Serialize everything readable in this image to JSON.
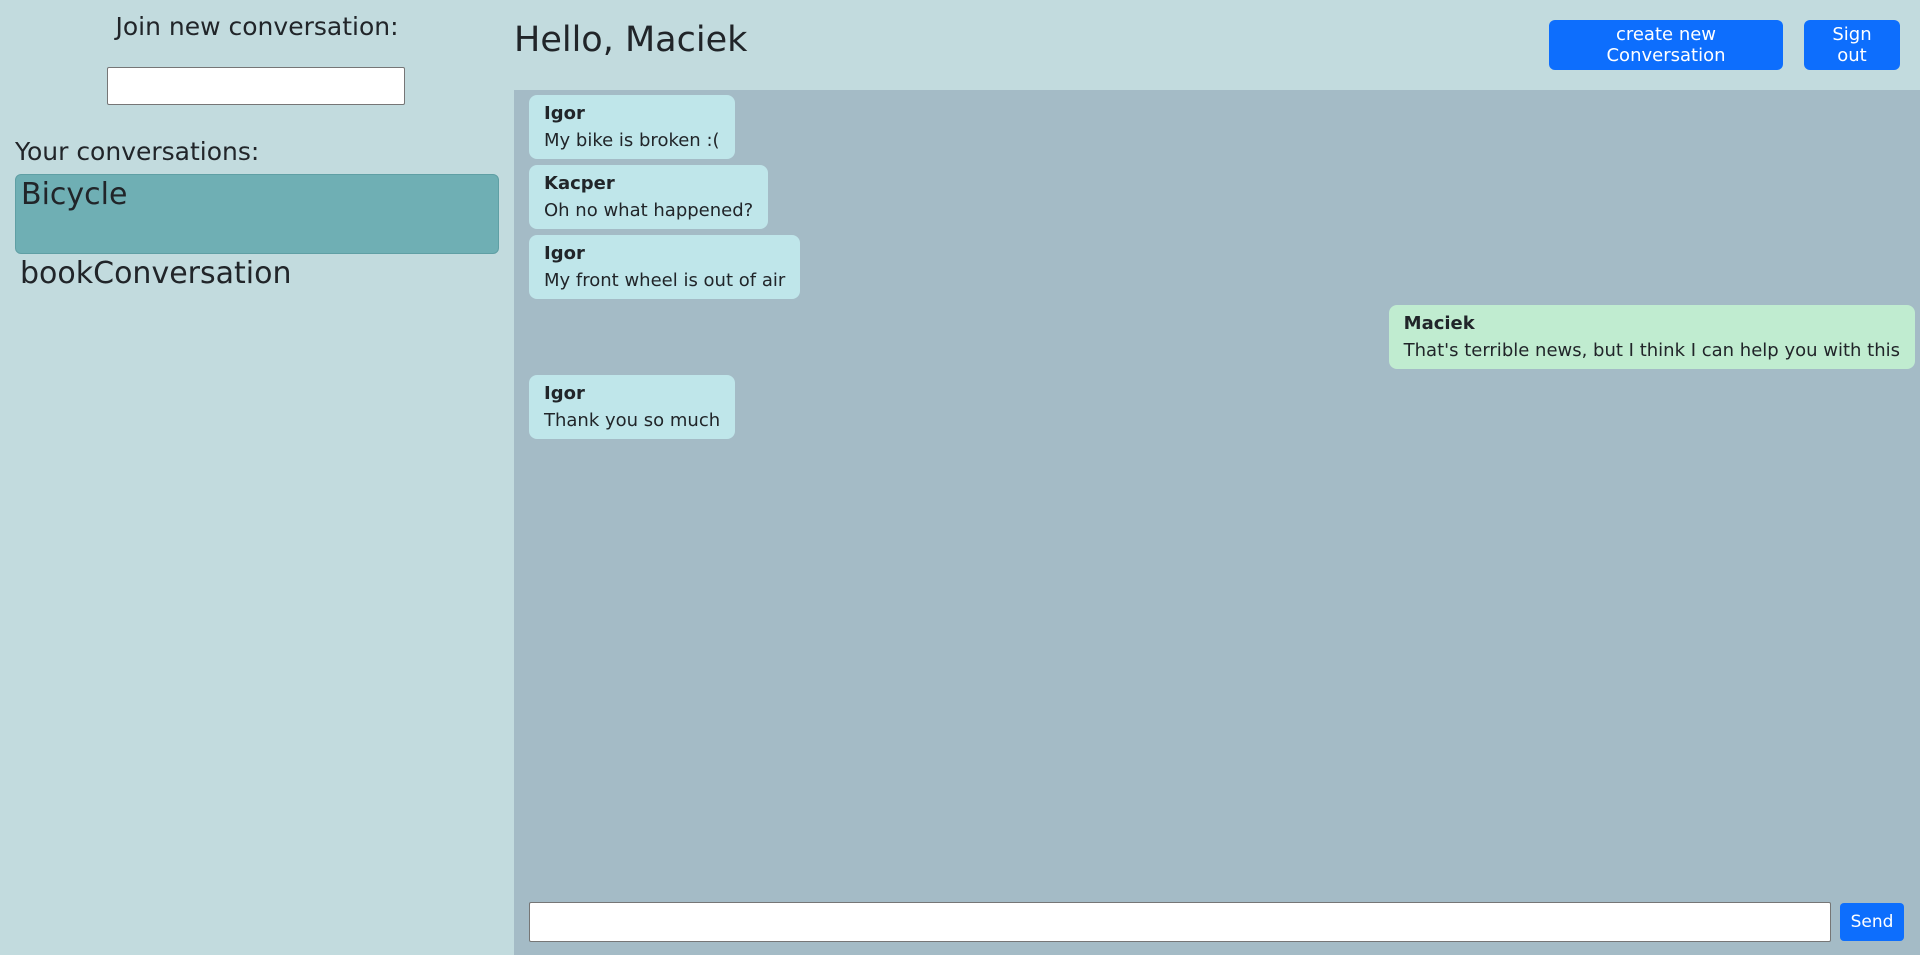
{
  "sidebar": {
    "join_label": "Join new conversation:",
    "join_input_value": "",
    "your_label": "Your conversations:",
    "conversations": [
      {
        "name": "Bicycle",
        "active": true
      },
      {
        "name": "bookConversation",
        "active": false
      }
    ]
  },
  "header": {
    "greeting": "Hello, Maciek",
    "create_label": "create new Conversation",
    "signout_label": "Sign out"
  },
  "messages": [
    {
      "sender": "Igor",
      "text": "My bike is broken :(",
      "mine": false
    },
    {
      "sender": "Kacper",
      "text": "Oh no what happened?",
      "mine": false
    },
    {
      "sender": "Igor",
      "text": "My front wheel is out of air",
      "mine": false
    },
    {
      "sender": "Maciek",
      "text": "That's terrible news, but I think I can help you with this",
      "mine": true
    },
    {
      "sender": "Igor",
      "text": "Thank you so much",
      "mine": false
    }
  ],
  "composer": {
    "input_value": "",
    "send_label": "Send"
  },
  "colors": {
    "background": "#c2dbde",
    "chat_background": "#a4bbc6",
    "active_conversation": "#6fafb4",
    "bubble_other": "#bfe6ea",
    "bubble_mine": "#c0ecd0",
    "primary_button": "#0d6efd"
  }
}
